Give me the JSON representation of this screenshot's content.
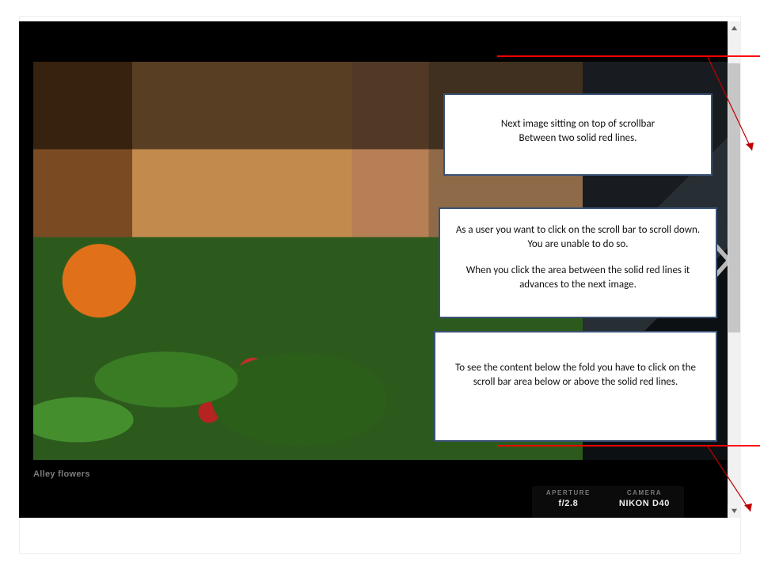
{
  "caption": "Alley flowers",
  "exif": {
    "aperture_label": "APERTURE",
    "aperture_value": "f/2.8",
    "camera_label": "CAMERA",
    "camera_value": "NIKON D40"
  },
  "callouts": {
    "c1_line1": "Next image sitting on top of scrollbar",
    "c1_line2": "Between two solid red lines.",
    "c2_p1": "As a user you want to click on the scroll bar to scroll down.  You are unable to do so.",
    "c2_p2": "When you click the area between the solid red lines it advances to the next image.",
    "c3": "To see the content below the fold you have to click on the scroll bar area below or above the solid red lines."
  },
  "icons": {
    "next": "chevron-right",
    "scroll_up": "triangle-up",
    "scroll_down": "triangle-down"
  }
}
